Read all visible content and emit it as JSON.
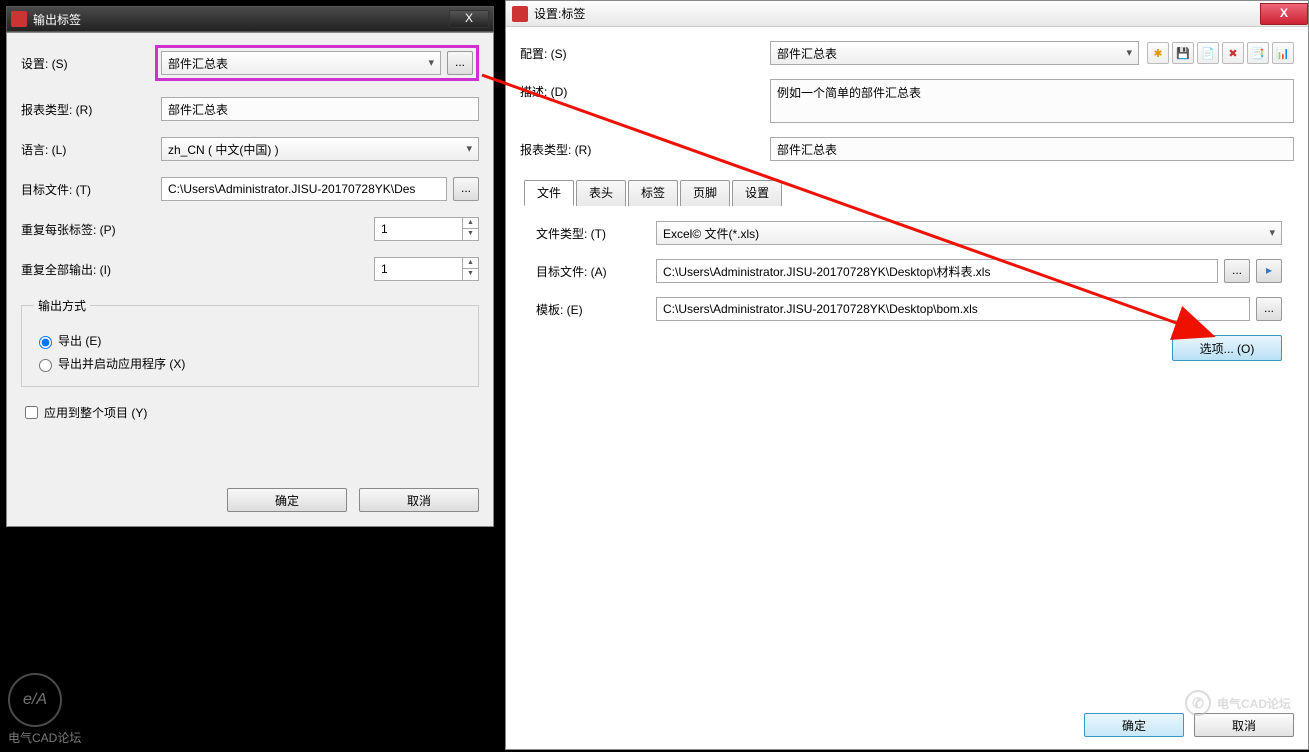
{
  "dialog1": {
    "title": "输出标签",
    "setting_label": "设置: (S)",
    "setting_value": "部件汇总表",
    "report_type_label": "报表类型: (R)",
    "report_type_value": "部件汇总表",
    "language_label": "语言: (L)",
    "language_value": "zh_CN ( 中文(中国) )",
    "target_label": "目标文件: (T)",
    "target_value": "C:\\Users\\Administrator.JISU-20170728YK\\Des",
    "repeat_each_label": "重复每张标签: (P)",
    "repeat_each_value": "1",
    "repeat_all_label": "重复全部输出: (I)",
    "repeat_all_value": "1",
    "output_mode_legend": "输出方式",
    "radio_export": "导出 (E)",
    "radio_export_launch": "导出并启动应用程序 (X)",
    "apply_whole_project": "应用到整个项目 (Y)",
    "ok": "确定",
    "cancel": "取消",
    "browse": "...",
    "close_x": "X"
  },
  "dialog2": {
    "title": "设置:标签",
    "config_label": "配置: (S)",
    "config_value": "部件汇总表",
    "desc_label": "描述: (D)",
    "desc_value": "例如一个简单的部件汇总表",
    "report_type_label": "报表类型: (R)",
    "report_type_value": "部件汇总表",
    "tabs": [
      "文件",
      "表头",
      "标签",
      "页脚",
      "设置"
    ],
    "file_type_label": "文件类型: (T)",
    "file_type_value": "Excel© 文件(*.xls)",
    "target_label": "目标文件: (A)",
    "target_value": "C:\\Users\\Administrator.JISU-20170728YK\\Desktop\\材料表.xls",
    "template_label": "模板: (E)",
    "template_value": "C:\\Users\\Administrator.JISU-20170728YK\\Desktop\\bom.xls",
    "options_btn": "选项... (O)",
    "ok": "确定",
    "cancel": "取消",
    "browse": "...",
    "play": "▸",
    "close_x": "X",
    "toolbar_icons": [
      "✱",
      "💾",
      "📄",
      "✖",
      "📑",
      "📊"
    ]
  },
  "watermark_left": "电气CAD论坛",
  "watermark_left_circle": "e/A",
  "watermark_right": "电气CAD论坛"
}
